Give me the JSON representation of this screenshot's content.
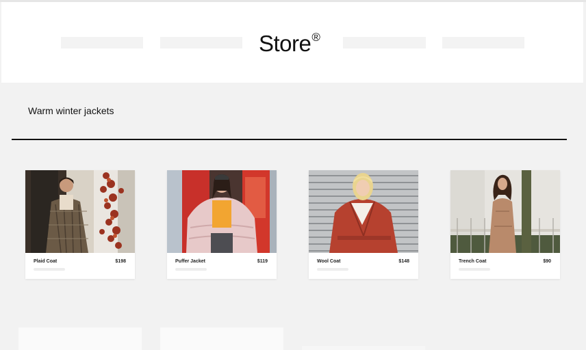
{
  "header": {
    "logo": "Store",
    "logo_mark": "®"
  },
  "section": {
    "title": "Warm winter jackets"
  },
  "products": [
    {
      "name": "Plaid Coat",
      "price": "$198"
    },
    {
      "name": "Puffer Jacket",
      "price": "$119"
    },
    {
      "name": "Wool Coat",
      "price": "$148"
    },
    {
      "name": "Trench Coat",
      "price": "$90"
    }
  ],
  "colors": {
    "background": "#f2f2f2",
    "header": "#ffffff",
    "text": "#111111"
  }
}
